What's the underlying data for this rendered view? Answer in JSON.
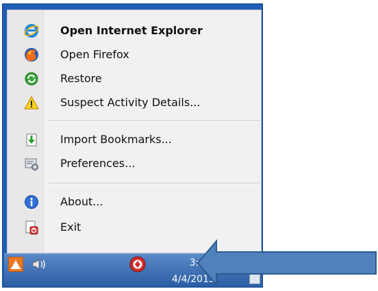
{
  "menu": {
    "items": [
      {
        "label": "Open Internet Explorer",
        "icon": "internet-explorer-icon",
        "bold": true
      },
      {
        "label": "Open Firefox",
        "icon": "firefox-icon"
      },
      {
        "label": "Restore",
        "icon": "restore-icon"
      },
      {
        "label": "Suspect Activity Details...",
        "icon": "warning-icon"
      },
      {
        "label": "Import Bookmarks...",
        "icon": "import-bookmarks-icon"
      },
      {
        "label": "Preferences...",
        "icon": "preferences-icon"
      },
      {
        "label": "About...",
        "icon": "info-icon"
      },
      {
        "label": "Exit",
        "icon": "exit-icon"
      }
    ]
  },
  "taskbar": {
    "time": "3:0",
    "date": "4/4/2013"
  },
  "colors": {
    "frame_blue": "#1f5fb8",
    "arrow_fill": "#4f81bd",
    "arrow_stroke": "#2d5a8c"
  }
}
